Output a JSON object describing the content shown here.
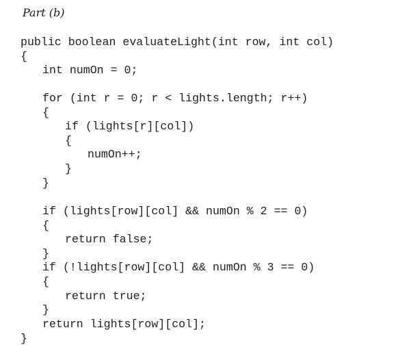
{
  "heading": "Part (b)",
  "code": {
    "lines": [
      "public boolean evaluateLight(int row, int col)",
      "{",
      "int numOn = 0;",
      "for (int r = 0; r < lights.length; r++)",
      "{",
      "if (lights[r][col])",
      "{",
      "numOn++;",
      "}",
      "}",
      "if (lights[row][col] && numOn % 2 == 0)",
      "{",
      "return false;",
      "}",
      "if (!lights[row][col] && numOn % 3 == 0)",
      "{",
      "return true;",
      "}",
      "return lights[row][col];",
      "}"
    ]
  }
}
